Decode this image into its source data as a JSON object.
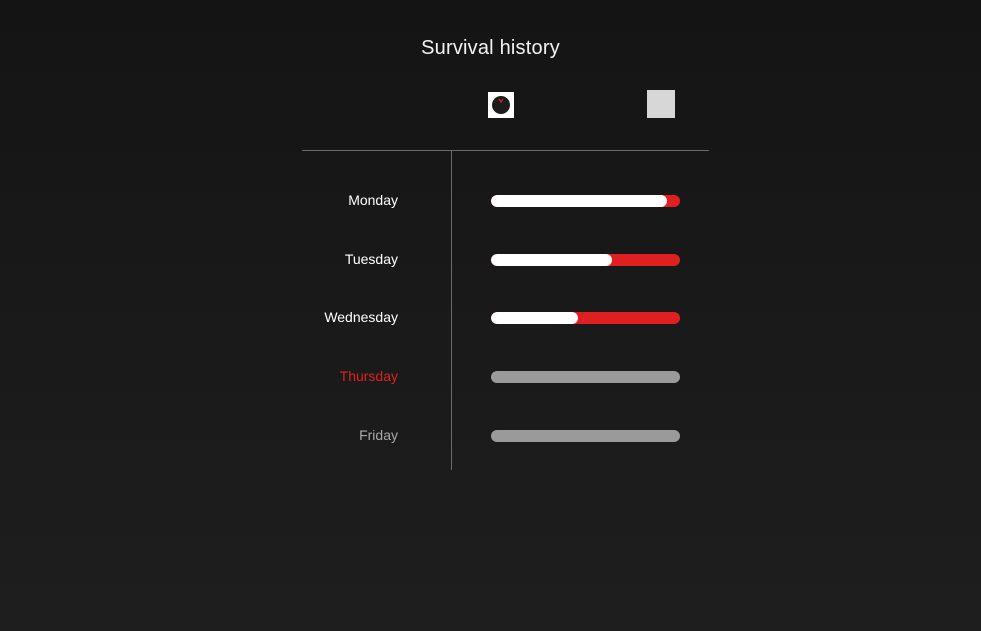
{
  "title": "Survival history",
  "header_icons": {
    "left": "survivor-avatar-icon",
    "right": "blank-square-icon"
  },
  "colors": {
    "survived": "#ffffff",
    "lost": "#e02020",
    "upcoming": "#9a9a9a",
    "today_label": "#e02020",
    "past_label": "#ffffff",
    "future_label": "#a8a8a8"
  },
  "days": [
    {
      "label": "Monday",
      "state": "past",
      "survived_fraction": 0.93
    },
    {
      "label": "Tuesday",
      "state": "past",
      "survived_fraction": 0.64
    },
    {
      "label": "Wednesday",
      "state": "past",
      "survived_fraction": 0.46
    },
    {
      "label": "Thursday",
      "state": "today",
      "survived_fraction": null
    },
    {
      "label": "Friday",
      "state": "future",
      "survived_fraction": null
    }
  ]
}
